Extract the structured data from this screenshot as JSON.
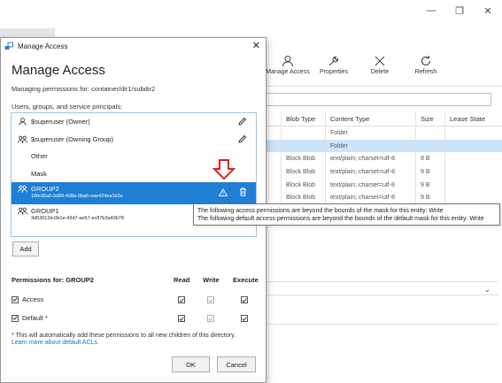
{
  "background": {
    "toolbar": [
      {
        "label": "Manage Access",
        "icon": "person-icon"
      },
      {
        "label": "Properties",
        "icon": "wrench-icon"
      },
      {
        "label": "Delete",
        "icon": "x-icon"
      },
      {
        "label": "Refresh",
        "icon": "refresh-icon"
      }
    ],
    "grid": {
      "columns": [
        "",
        "Blob Type",
        "Content Type",
        "Size",
        "Lease State"
      ],
      "rows": [
        [
          "",
          "",
          "Folder",
          "",
          ""
        ],
        [
          "",
          "",
          "Folder",
          "",
          ""
        ],
        [
          "",
          "Block Blob",
          "text/plain; charset=utf-8",
          "9 B",
          ""
        ],
        [
          "",
          "Block Blob",
          "text/plain; charset=utf-8",
          "9 B",
          ""
        ],
        [
          "",
          "Block Blob",
          "text/plain; charset=utf-8",
          "9 B",
          ""
        ],
        [
          "",
          "Block Blob",
          "text/plain; charset=utf-8",
          "9 B",
          ""
        ]
      ],
      "selected_row": 1
    },
    "tooltip": {
      "line1": "The following access permissions are beyond the bounds of the mask for this entity: Write",
      "line2": "The following default access permissions are beyond the bounds of the default mask for this entity: Write"
    }
  },
  "dialog": {
    "window_title": "Manage Access",
    "heading": "Manage Access",
    "subtitle": "Managing permissions for: container/dir1/subdir2",
    "list_label": "Users, groups, and service principals:",
    "principals": [
      {
        "name": "$superuser (Owner)",
        "icon": "person-icon",
        "editable": true
      },
      {
        "name": "$superuser (Owning Group)",
        "icon": "group-icon",
        "editable": true
      },
      {
        "name": "Other",
        "icon": "",
        "editable": false
      },
      {
        "name": "Mask",
        "icon": "",
        "editable": false
      },
      {
        "name": "GROUP2",
        "id": "18fe35a0-3d99-438a-9ba6-eae424ea1b3e",
        "icon": "group-icon",
        "selected": true,
        "warning": true
      },
      {
        "name": "GROUP1",
        "id": "3d53012d-0b1e-43d7-ae57-ec87b3a43b78",
        "icon": "group-icon"
      }
    ],
    "add_label": "Add",
    "permissions": {
      "title": "Permissions for: GROUP2",
      "columns": [
        "Read",
        "Write",
        "Execute"
      ],
      "rows": [
        {
          "label": "Access",
          "enabled": true,
          "read": true,
          "write": true,
          "execute": true
        },
        {
          "label": "Default *",
          "enabled": true,
          "read": true,
          "write": true,
          "execute": true
        }
      ]
    },
    "note": "* This will automatically add these permissions to all new children of this directory.",
    "learn_more": "Learn more about default ACLs.",
    "ok_label": "OK",
    "cancel_label": "Cancel",
    "accent_color": "#1e7fd4",
    "arrow_color": "#e02020"
  }
}
